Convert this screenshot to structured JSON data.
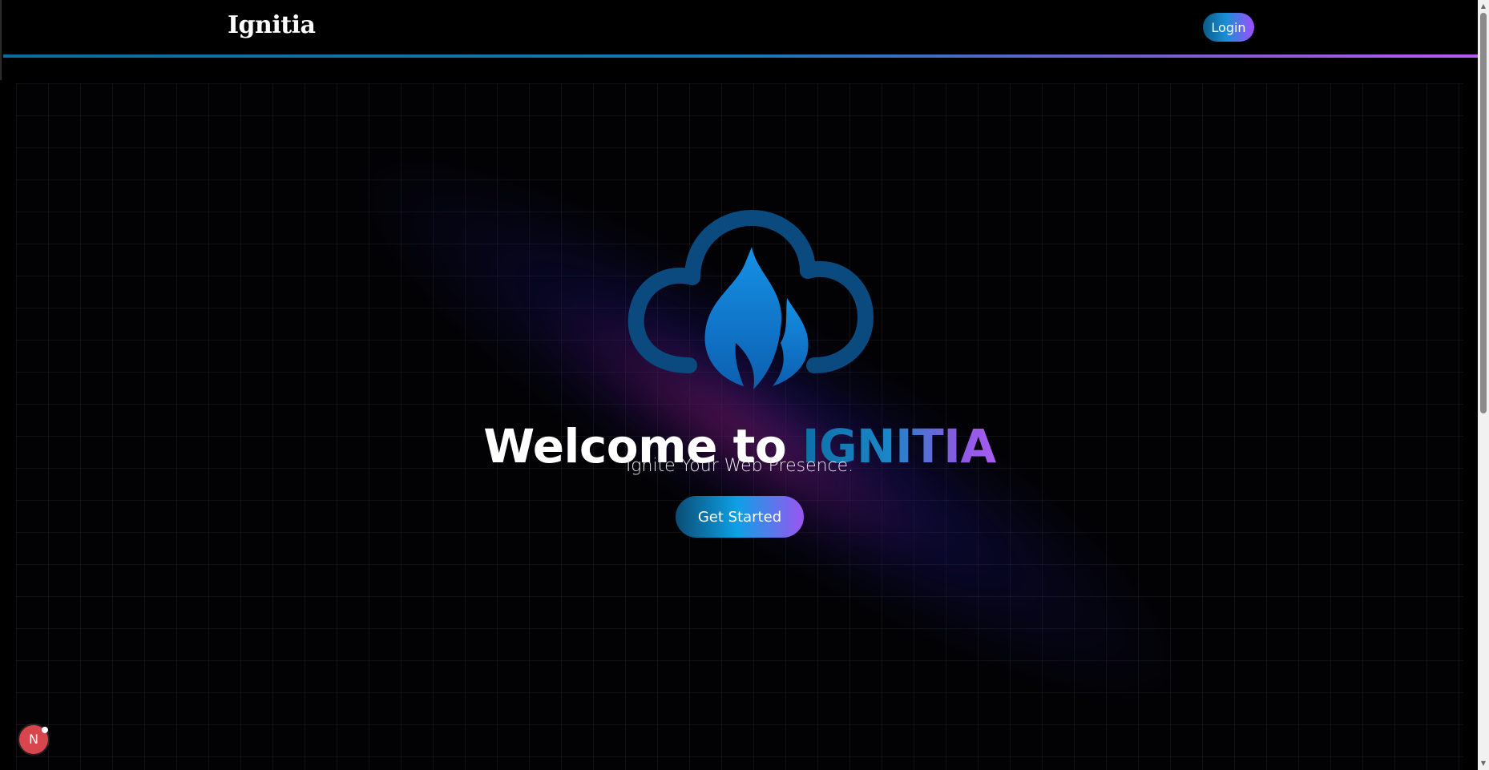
{
  "navbar": {
    "brand": "Ignitia",
    "login_label": "Login"
  },
  "hero": {
    "logo_icon": "cloud-flame-icon",
    "headline_prefix": "Welcome to ",
    "headline_accent": "IGNITIA",
    "tagline": "Ignite Your Web Presence.",
    "cta_label": "Get Started"
  },
  "floating_badge": {
    "letter": "N"
  },
  "colors": {
    "background": "#000000",
    "accent_blue": "#0ea0e6",
    "accent_purple": "#a14dff",
    "badge_red": "#d8454c"
  }
}
